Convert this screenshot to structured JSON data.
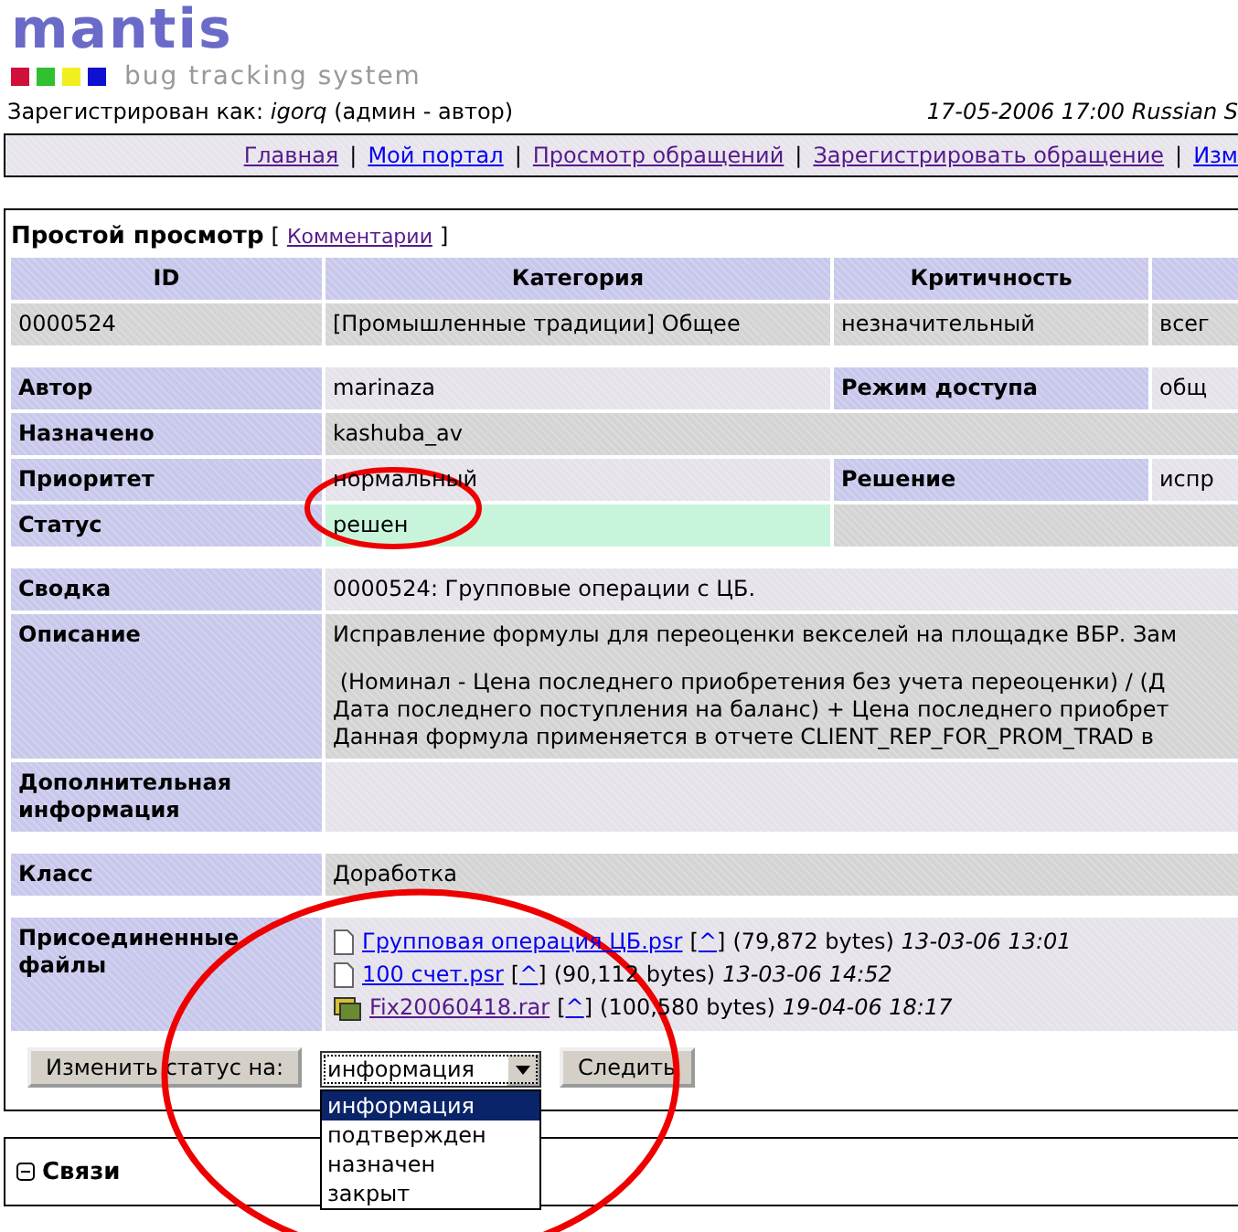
{
  "logo": {
    "title": "mantis",
    "subtitle": "bug tracking system"
  },
  "login": {
    "text": "Зарегистрирован как: *igorq* (админ - автор)",
    "datetime": "17-05-2006 17:00 Russian S"
  },
  "nav": [
    {
      "kind": "link",
      "label": "Главная",
      "visited": true
    },
    {
      "kind": "separator",
      "label": "|"
    },
    {
      "kind": "link",
      "label": "Мой портал",
      "visited": false
    },
    {
      "kind": "separator",
      "label": "|"
    },
    {
      "kind": "link",
      "label": "Просмотр обращений",
      "visited": true
    },
    {
      "kind": "separator",
      "label": "|"
    },
    {
      "kind": "link",
      "label": "Зарегистрировать обращение",
      "visited": true
    },
    {
      "kind": "separator",
      "label": "|"
    },
    {
      "kind": "link",
      "label": "Изм",
      "visited": false
    }
  ],
  "view": {
    "title": "Простой просмотр",
    "bracket_open": "[",
    "link": "Комментарии",
    "bracket_close": "]"
  },
  "table": {
    "columns": [
      "ID",
      "Категория",
      "Критичность"
    ],
    "row": [
      "0000524",
      "[Промышленные традиции] Общее",
      "незначительный",
      "всег"
    ]
  },
  "fields": [
    [
      {
        "label": "Автор",
        "value": "marinaza",
        "label2": "Режим доступа",
        "value2": "общ"
      },
      {
        "label": "Назначено",
        "value": "kashuba_av"
      },
      {
        "label": "Приоритет",
        "value": "нормальный",
        "label2": "Решение",
        "value2": "испр"
      },
      {
        "label": "Статус",
        "value": "решен",
        "color": "#c8f4dc"
      }
    ],
    [
      {
        "label": "Сводка",
        "value": "0000524: Групповые операции с ЦБ."
      },
      {
        "label": "Описание",
        "paragraphs": [
          [
            "Исправление формулы для переоценки векселей на площадке ВБР. Зам"
          ],
          [
            " (Номинал - Цена последнего приобретения без учета переоценки) / (Д",
            "Дата последнего поступления на баланс) + Цена последнего приобрет",
            "Данная формула применяется в отчете CLIENT_REP_FOR_PROM_TRAD в"
          ]
        ]
      },
      {
        "label": "Дополнительная информация"
      }
    ],
    [
      {
        "label": "Класс",
        "value": "Доработка"
      }
    ],
    [
      {
        "label": "Присоединенные файлы",
        "files": [
          {
            "kind": "document",
            "name": "Групповая операция ЦБ.psr",
            "visited": false,
            "open": "[",
            "caret": "^",
            "close": "]",
            "size": "(79,872 bytes)",
            "date": "13-03-06 13:01"
          },
          {
            "kind": "document",
            "name": "100 счет.psr",
            "visited": false,
            "open": "[",
            "caret": "^",
            "close": "]",
            "size": "(90,112 bytes)",
            "date": "13-03-06 14:52"
          },
          {
            "kind": "archive",
            "name": "Fix20060418.rar",
            "visited": true,
            "open": "[",
            "caret": "^",
            "close": "]",
            "size": "(100,580 bytes)",
            "date": "19-04-06 18:17"
          }
        ]
      }
    ]
  ],
  "actions": {
    "change_button": "Изменить статус на:",
    "select": {
      "value": "информация",
      "expanded": true,
      "options": [
        {
          "label": "информация",
          "selected": true
        },
        {
          "label": "подтвержден",
          "selected": false
        },
        {
          "label": "назначен",
          "selected": false
        },
        {
          "label": "закрыт",
          "selected": false
        }
      ]
    },
    "monitor_button": "Следить"
  },
  "relations": {
    "title": "Связи",
    "expanded": true
  }
}
